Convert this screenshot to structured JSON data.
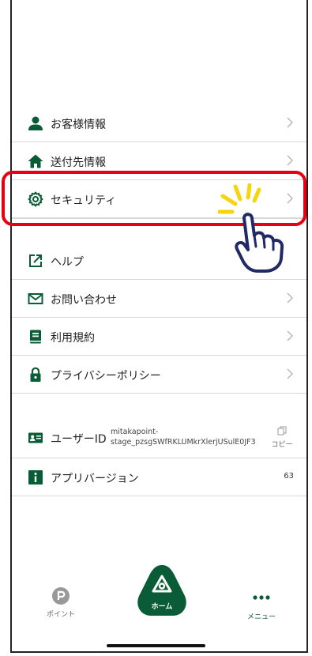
{
  "menu": {
    "customer_info": "お客様情報",
    "shipping_info": "送付先情報",
    "security": "セキュリティ",
    "help": "ヘルプ",
    "contact": "お問い合わせ",
    "terms": "利用規約",
    "privacy": "プライバシーポリシー"
  },
  "info": {
    "user_id_label": "ユーザーID",
    "user_id_value_line1": "mitakapoint-",
    "user_id_value_line2": "stage_pzsgSWfRKLUMkrXlerjUSulE0JF3",
    "copy_label": "コピー",
    "app_version_label": "アプリバージョン",
    "app_version_value": "63"
  },
  "tabbar": {
    "point_label": "ポイント",
    "home_label": "ホーム",
    "menu_label": "メニュー"
  },
  "colors": {
    "brand_green": "#0a5c36",
    "highlight_red": "#e60012"
  }
}
